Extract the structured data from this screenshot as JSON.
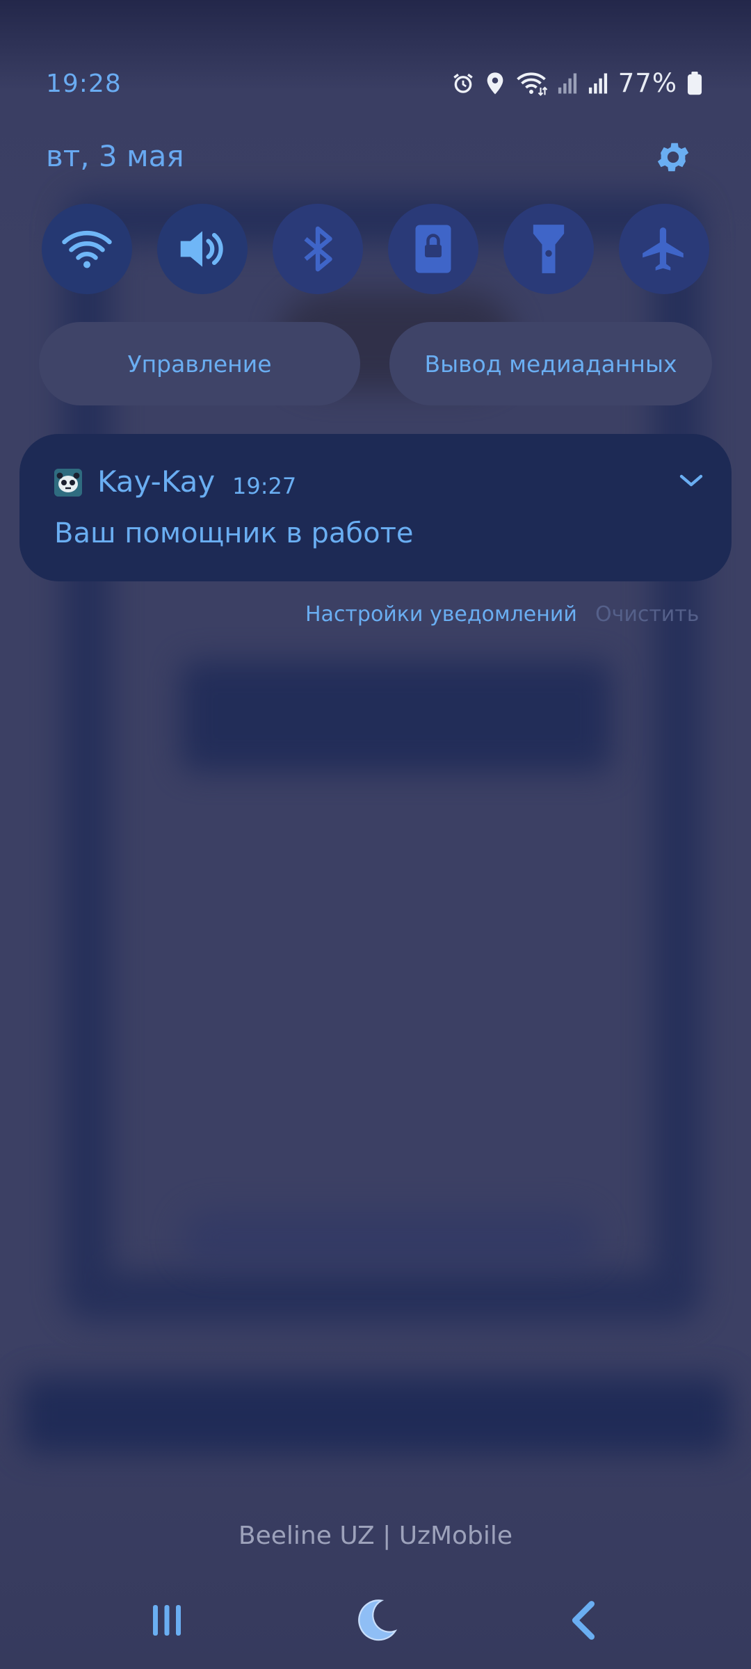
{
  "status_bar": {
    "time": "19:28",
    "battery_percent": "77%",
    "icons": [
      "alarm-icon",
      "location-icon",
      "wifi-icon",
      "signal-sim1-icon",
      "signal-sim2-icon",
      "battery-icon"
    ]
  },
  "panel": {
    "date": "вт, 3 мая",
    "settings_icon": "gear-icon"
  },
  "quick_settings": [
    {
      "name": "wifi",
      "icon": "wifi-icon",
      "active": true
    },
    {
      "name": "sound",
      "icon": "speaker-icon",
      "active": true
    },
    {
      "name": "bluetooth",
      "icon": "bluetooth-icon",
      "active": false
    },
    {
      "name": "screen-lock",
      "icon": "lock-rotation-icon",
      "active": false
    },
    {
      "name": "flashlight",
      "icon": "flashlight-icon",
      "active": false
    },
    {
      "name": "airplane",
      "icon": "airplane-icon",
      "active": false
    }
  ],
  "panel_buttons": {
    "device_control": "Управление",
    "media_output": "Вывод медиаданных"
  },
  "notification": {
    "app_name": "Kay-Kay",
    "time": "19:27",
    "body": "Ваш помощник в работе"
  },
  "notification_actions": {
    "settings": "Настройки уведомлений",
    "clear": "Очистить"
  },
  "carrier": "Beeline UZ | UzMobile",
  "colors": {
    "accent": "#6aaef2",
    "tile_bg": "#2a3a78",
    "card_bg": "#1d2a55",
    "panel_bg": "#3c4064"
  }
}
